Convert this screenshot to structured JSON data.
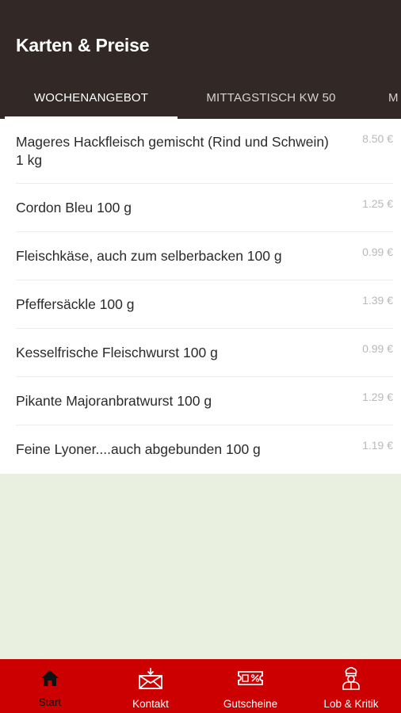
{
  "header": {
    "title": "Karten & Preise"
  },
  "tabs": [
    {
      "label": "Wochenangebot"
    },
    {
      "label": "Mittagstisch KW 50"
    },
    {
      "label": "M"
    }
  ],
  "items": [
    {
      "name": "Mageres Hackfleisch gemischt (Rind und Schwein) 1 kg",
      "price": "8.50 €"
    },
    {
      "name": "Cordon Bleu 100 g",
      "price": "1.25 €"
    },
    {
      "name": "Fleischkäse, auch zum selberbacken 100 g",
      "price": "0.99 €"
    },
    {
      "name": "Pfeffersäckle 100 g",
      "price": "1.39 €"
    },
    {
      "name": "Kesselfrische Fleischwurst 100 g",
      "price": "0.99 €"
    },
    {
      "name": "Pikante Majoranbratwurst 100 g",
      "price": "1.29 €"
    },
    {
      "name": "Feine Lyoner....auch abgebunden 100 g",
      "price": "1.19 €"
    }
  ],
  "bottom_nav": [
    {
      "label": "Start",
      "icon": "home-icon"
    },
    {
      "label": "Kontakt",
      "icon": "mail-icon"
    },
    {
      "label": "Gutscheine",
      "icon": "voucher-icon"
    },
    {
      "label": "Lob & Kritik",
      "icon": "chef-icon"
    }
  ],
  "colors": {
    "header_bg": "#322926",
    "bottom_bar_bg": "#cc0000",
    "content_bg": "#e9f0e0"
  }
}
